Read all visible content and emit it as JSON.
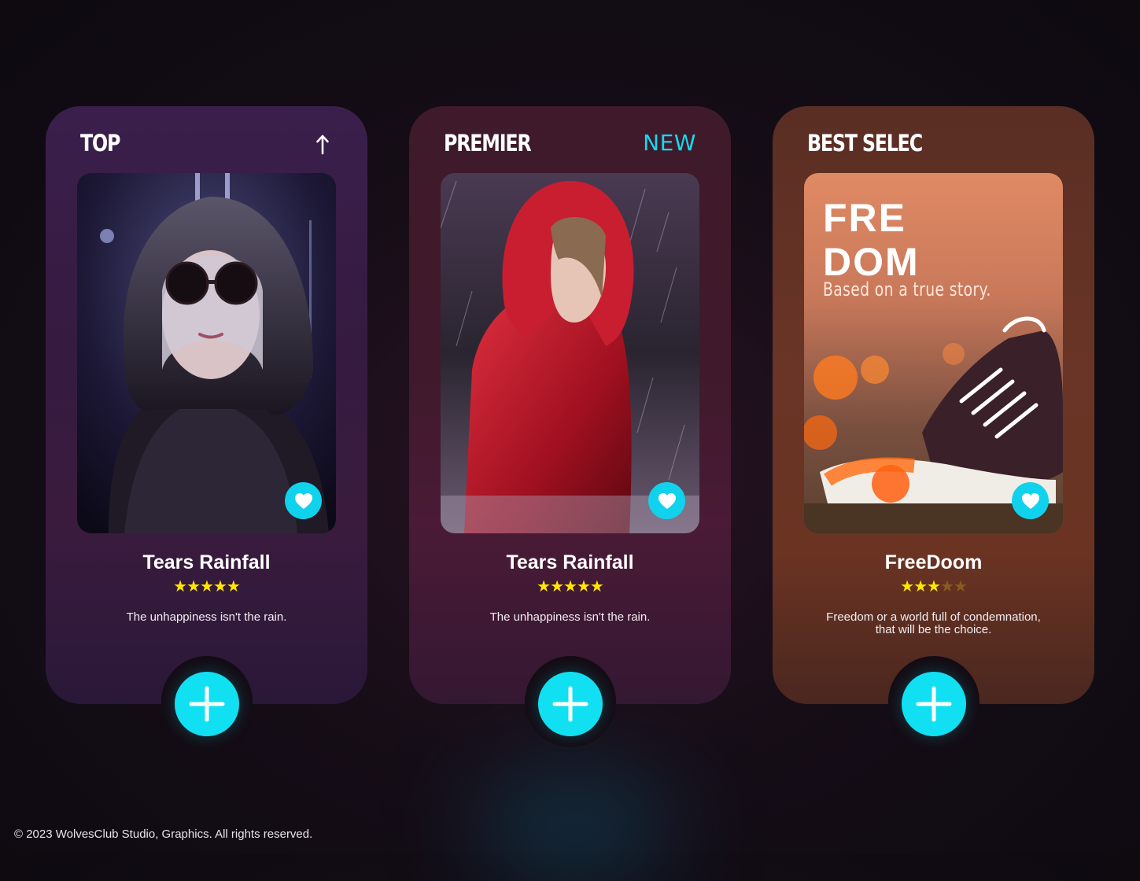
{
  "cards": [
    {
      "label": "TOP",
      "title": "Tears Rainfall",
      "rating": 5,
      "stars": "★★★★★",
      "description": "The unhappiness isn't the rain.",
      "icons": {
        "corner": "arrow-up-icon",
        "favorite": "heart-icon",
        "add": "plus-icon"
      }
    },
    {
      "label": "PREMIER",
      "badge": "NEW",
      "title": "Tears Rainfall",
      "rating": 5,
      "stars": "★★★★★",
      "description": "The unhappiness isn't the rain.",
      "icons": {
        "favorite": "heart-icon",
        "add": "plus-icon"
      }
    },
    {
      "label": "BEST SELEC",
      "title": "FreeDoom",
      "rating": 3,
      "stars_on": "★★★",
      "stars_off": "★★",
      "description": "Freedom or a world full of condemnation, that will be the choice.",
      "poster": {
        "title_line1": "FRE",
        "title_line2": "DOM",
        "tagline": "Based on a true story."
      },
      "icons": {
        "favorite": "heart-icon",
        "add": "plus-icon"
      }
    }
  ],
  "colors": {
    "accent": "#11e0f2",
    "badge": "#15d8f0",
    "star": "#ffe600"
  },
  "footer": "© 2023 WolvesClub Studio, Graphics. All rights reserved."
}
